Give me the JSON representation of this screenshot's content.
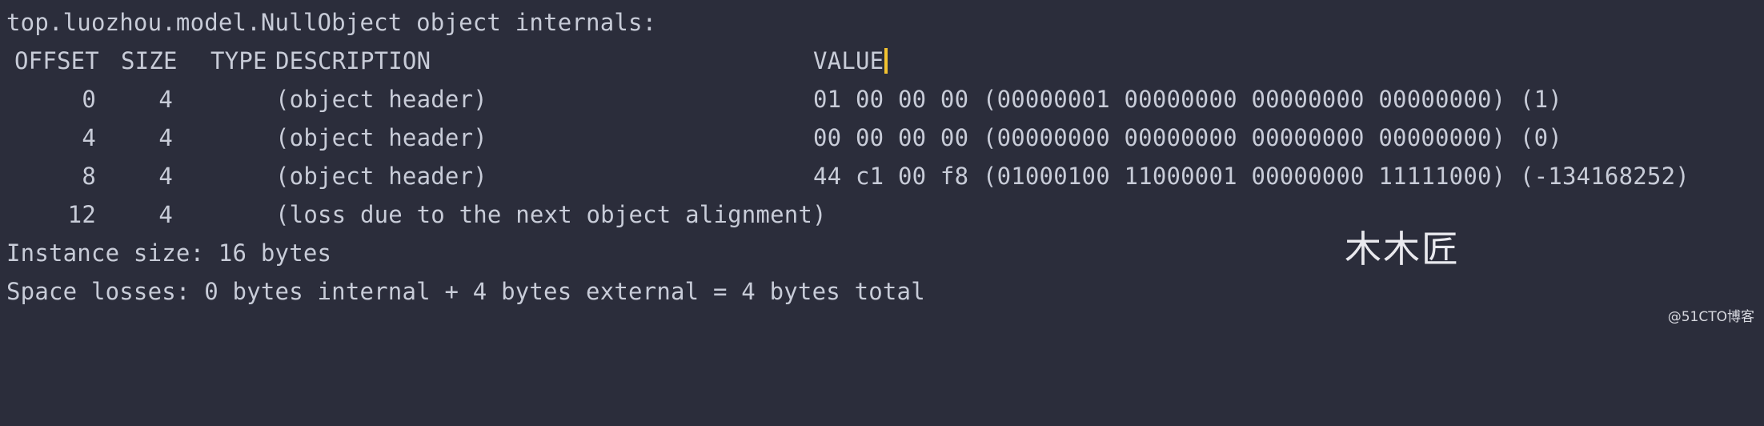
{
  "header_line": "top.luozhou.model.NullObject object internals:",
  "columns": {
    "offset": "OFFSET",
    "size": "SIZE",
    "type": "TYPE",
    "description": "DESCRIPTION",
    "value": "VALUE"
  },
  "rows": [
    {
      "offset": "0",
      "size": "4",
      "description": "(object header)",
      "value": "01 00 00 00 (00000001 00000000 00000000 00000000) (1)"
    },
    {
      "offset": "4",
      "size": "4",
      "description": "(object header)",
      "value": "00 00 00 00 (00000000 00000000 00000000 00000000) (0)"
    },
    {
      "offset": "8",
      "size": "4",
      "description": "(object header)",
      "value": "44 c1 00 f8 (01000100 11000001 00000000 11111000) (-134168252)"
    },
    {
      "offset": "12",
      "size": "4",
      "description": "(loss due to the next object alignment)",
      "value": ""
    }
  ],
  "instance_size": "Instance size: 16 bytes",
  "space_losses": "Space losses: 0 bytes internal + 4 bytes external = 4 bytes total",
  "watermark": "木木匠",
  "source_mark": "@51CTO博客",
  "colors": {
    "background": "#2b2d3b",
    "text": "#c8ccd8",
    "cursor": "#f2c230"
  }
}
